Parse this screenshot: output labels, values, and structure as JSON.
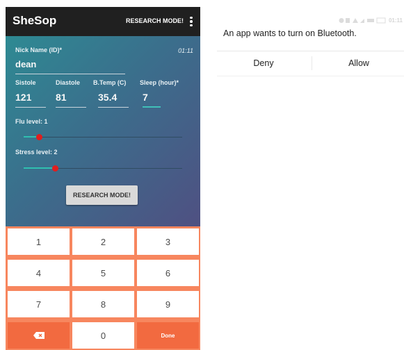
{
  "app": {
    "title": "SheSop",
    "action_label": "RESEARCH MODE!"
  },
  "form": {
    "nickname_label": "Nick Name (ID)*",
    "nickname_value": "dean",
    "time": "01:11",
    "vitals": [
      {
        "label": "Sistole",
        "value": "121"
      },
      {
        "label": "Diastole",
        "value": "81"
      },
      {
        "label": "B.Temp (C)",
        "value": "35.4"
      },
      {
        "label": "Sleep (hour)*",
        "value": "7"
      }
    ],
    "flu": {
      "label": "Flu level: 1",
      "value": 1
    },
    "stress": {
      "label": "Stress level: 2",
      "value": 2
    },
    "research_button": "RESEARCH MODE!"
  },
  "keypad": {
    "keys": [
      "1",
      "2",
      "3",
      "4",
      "5",
      "6",
      "7",
      "8",
      "9",
      "⌫",
      "0",
      "Done"
    ]
  },
  "dialog": {
    "message": "An app wants to turn on Bluetooth.",
    "deny": "Deny",
    "allow": "Allow",
    "status_bar": "01:11"
  },
  "colors": {
    "app_bar": "#202020",
    "keypad_orange": "#f26a40",
    "slider_thumb": "#e01e1e",
    "slider_fill": "#2fc0b0"
  },
  "icons": {
    "overflow": "more-vert-icon",
    "backspace": "backspace-icon"
  }
}
